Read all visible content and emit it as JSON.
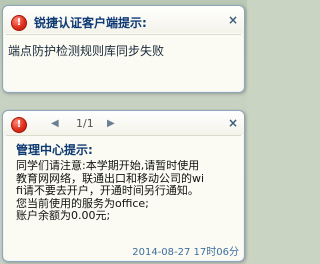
{
  "popup_top": {
    "title": "锐捷认证客户端提示:",
    "message": "端点防护检测规则库同步失败",
    "icon": "error-icon",
    "close_symbol": "×"
  },
  "popup_bottom": {
    "pager": {
      "prev": "◀",
      "text": "1/1",
      "next": "▶"
    },
    "title": "管理中心提示:",
    "icon": "error-icon",
    "close_symbol": "×",
    "lines": [
      "同学们请注意:本学期开始,请暂时使用",
      "教育网网络，联通出口和移动公司的wi",
      "fi请不要去开户，开通时间另行通知。",
      "您当前使用的服务为office;",
      "账户余额为0.00元;"
    ],
    "timestamp": "2014-08-27 17时06分"
  },
  "colors": {
    "title": "#0e3a74",
    "timestamp": "#3c6e9f",
    "error_icon": "#e0301e"
  }
}
